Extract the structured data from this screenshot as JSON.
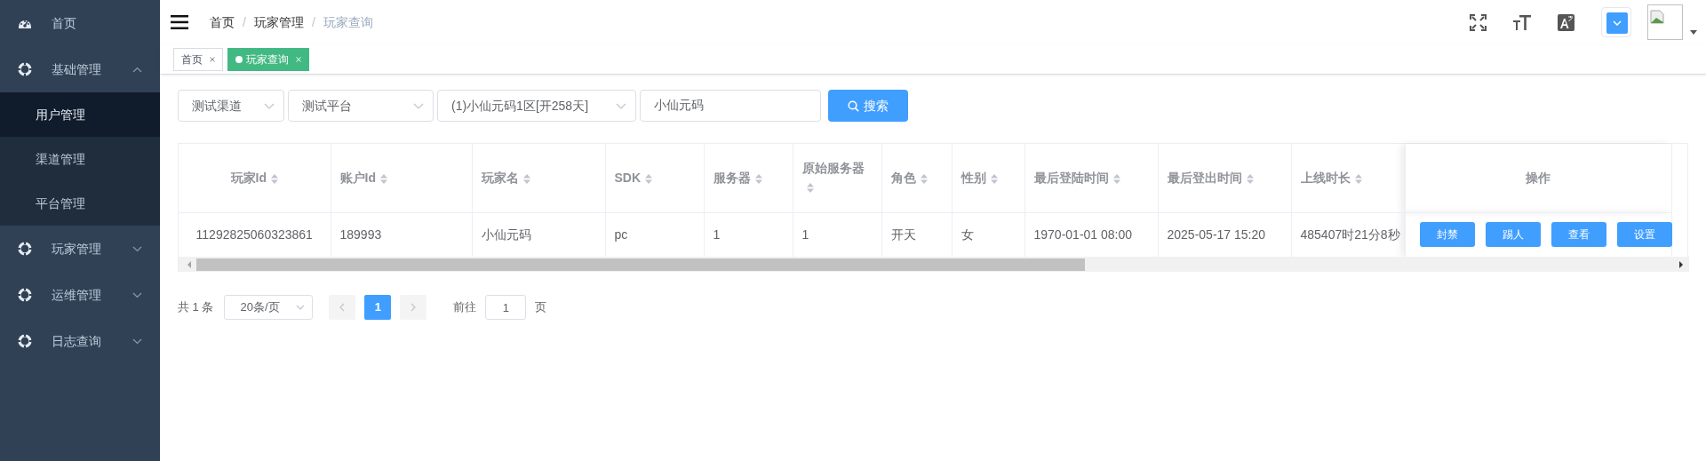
{
  "sidebar": {
    "items": [
      {
        "kind": "link",
        "label": "首页",
        "selected": false
      },
      {
        "kind": "group",
        "label": "基础管理",
        "expanded": true,
        "children": [
          {
            "label": "用户管理",
            "selected": true
          },
          {
            "label": "渠道管理",
            "selected": false
          },
          {
            "label": "平台管理",
            "selected": false
          }
        ]
      },
      {
        "kind": "group",
        "label": "玩家管理",
        "expanded": false
      },
      {
        "kind": "group",
        "label": "运维管理",
        "expanded": false
      },
      {
        "kind": "group",
        "label": "日志查询",
        "expanded": false
      }
    ]
  },
  "breadcrumb": [
    {
      "label": "首页"
    },
    {
      "separator": "/",
      "label": "玩家管理"
    },
    {
      "separator": "/",
      "label": "玩家查询"
    }
  ],
  "tags": [
    {
      "label": "首页",
      "selected": false
    },
    {
      "label": "玩家查询",
      "selected": true
    }
  ],
  "filters": {
    "selects": [
      {
        "value": "测试渠道"
      },
      {
        "value": "测试平台"
      },
      {
        "value": "(1)小仙元码1区[开258天]"
      }
    ],
    "search_input": {
      "value": "小仙元码"
    },
    "search_button": "搜索"
  },
  "table": {
    "columns": [
      {
        "label": "玩家Id",
        "sortable": true
      },
      {
        "label": "账户Id",
        "sortable": true
      },
      {
        "label": "玩家名",
        "sortable": true
      },
      {
        "label": "SDK",
        "sortable": true
      },
      {
        "label": "服务器",
        "sortable": true
      },
      {
        "label": "原始服务器",
        "sortable": true
      },
      {
        "label": "角色",
        "sortable": true
      },
      {
        "label": "性别",
        "sortable": true
      },
      {
        "label": "最后登陆时间",
        "sortable": true
      },
      {
        "label": "最后登出时间",
        "sortable": true
      },
      {
        "label": "上线时长",
        "sortable": true
      },
      {
        "label": "操作",
        "sortable": false
      }
    ],
    "rows": [
      {
        "cells": [
          "11292825060323861",
          "189993",
          "小仙元码",
          "pc",
          "1",
          "1",
          "开天",
          "女",
          "1970-01-01 08:00",
          "2025-05-17 15:20",
          "485407时21分8秒"
        ],
        "actions": [
          "封禁",
          "踢人",
          "查看",
          "设置"
        ]
      }
    ]
  },
  "pagination": {
    "total": "共 1 条",
    "page_size": "20条/页",
    "pages": [
      {
        "label": "1",
        "selected": true
      }
    ],
    "goto_label": "前往",
    "goto_value": "1",
    "goto_suffix": "页"
  }
}
